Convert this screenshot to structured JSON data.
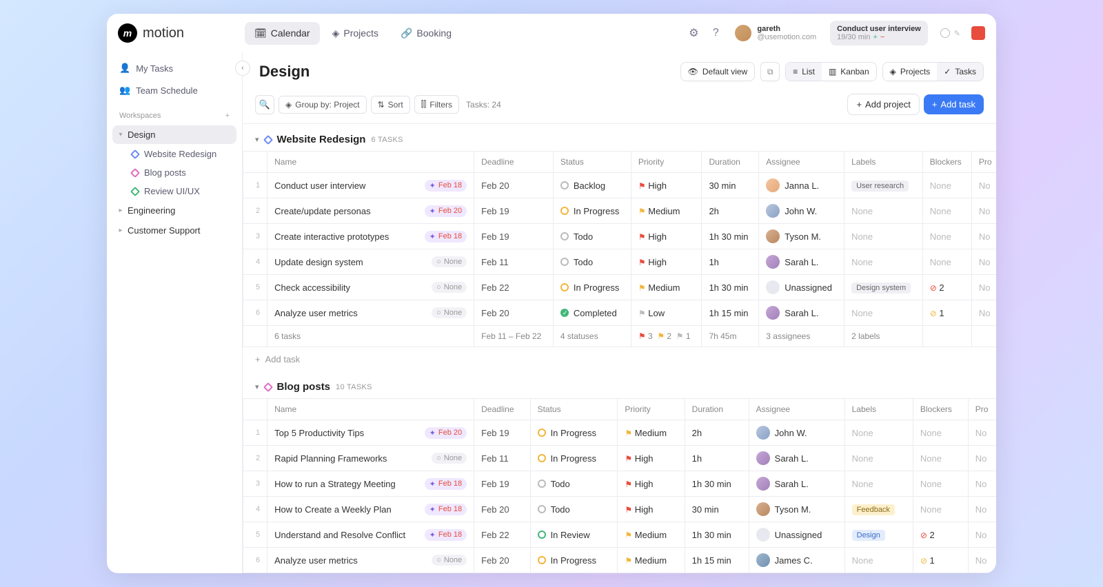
{
  "brand": "motion",
  "topnav": {
    "calendar": "Calendar",
    "projects": "Projects",
    "booking": "Booking"
  },
  "user": {
    "name": "gareth",
    "email": "@usemotion.com"
  },
  "timer": {
    "title": "Conduct user interview",
    "sub": "19/30 min"
  },
  "sidebar": {
    "mytasks": "My Tasks",
    "team": "Team Schedule",
    "wslabel": "Workspaces",
    "design": "Design",
    "wr": "Website Redesign",
    "bp": "Blog posts",
    "ru": "Review UI/UX",
    "eng": "Engineering",
    "cs": "Customer Support"
  },
  "page": {
    "title": "Design",
    "default_view": "Default view",
    "list": "List",
    "kanban": "Kanban",
    "projects_tab": "Projects",
    "tasks_tab": "Tasks"
  },
  "toolbar": {
    "group": "Group by: Project",
    "sort": "Sort",
    "filters": "Filters",
    "count": "Tasks: 24",
    "add_project": "Add project",
    "add_task": "Add task"
  },
  "headers": {
    "name": "Name",
    "deadline": "Deadline",
    "status": "Status",
    "priority": "Priority",
    "duration": "Duration",
    "assignee": "Assignee",
    "labels": "Labels",
    "blockers": "Blockers",
    "project": "Pro"
  },
  "projA": {
    "title": "Website Redesign",
    "count": "6 TASKS",
    "rows": [
      {
        "i": "1",
        "name": "Conduct user interview",
        "auto": "Feb 18",
        "autotype": "sched",
        "dl": "Feb 20",
        "st": "Backlog",
        "stc": "backlog",
        "pr": "High",
        "prc": "high",
        "dur": "30 min",
        "as": "Janna L.",
        "av": "av1",
        "lbl": "User research",
        "lblc": "tag-gray",
        "blk": "None",
        "prj": "No"
      },
      {
        "i": "2",
        "name": "Create/update personas",
        "auto": "Feb 20",
        "autotype": "sched",
        "dl": "Feb 19",
        "st": "In Progress",
        "stc": "prog",
        "pr": "Medium",
        "prc": "med",
        "dur": "2h",
        "as": "John W.",
        "av": "av2",
        "lbl": "None",
        "lblc": "",
        "blk": "None",
        "prj": "No"
      },
      {
        "i": "3",
        "name": "Create interactive prototypes",
        "auto": "Feb 18",
        "autotype": "sched",
        "dl": "Feb 19",
        "st": "Todo",
        "stc": "todo",
        "pr": "High",
        "prc": "high",
        "dur": "1h 30 min",
        "as": "Tyson M.",
        "av": "av3",
        "lbl": "None",
        "lblc": "",
        "blk": "None",
        "prj": "No"
      },
      {
        "i": "4",
        "name": "Update design system",
        "auto": "None",
        "autotype": "none",
        "dl": "Feb 11",
        "st": "Todo",
        "stc": "todo",
        "pr": "High",
        "prc": "high",
        "dur": "1h",
        "as": "Sarah L.",
        "av": "av4",
        "lbl": "None",
        "lblc": "",
        "blk": "None",
        "prj": "No"
      },
      {
        "i": "5",
        "name": "Check accessibility",
        "auto": "None",
        "autotype": "none",
        "dl": "Feb 22",
        "st": "In Progress",
        "stc": "prog",
        "pr": "Medium",
        "prc": "med",
        "dur": "1h 30 min",
        "as": "Unassigned",
        "av": "av-un",
        "lbl": "Design system",
        "lblc": "tag-gray",
        "blk": "2",
        "blkico": "r",
        "prj": "No"
      },
      {
        "i": "6",
        "name": "Analyze user metrics",
        "auto": "None",
        "autotype": "none",
        "dl": "Feb 20",
        "st": "Completed",
        "stc": "done",
        "pr": "Low",
        "prc": "low",
        "dur": "1h 15 min",
        "as": "Sarah L.",
        "av": "av4",
        "lbl": "None",
        "lblc": "",
        "blk": "1",
        "blkico": "y",
        "prj": "No"
      }
    ],
    "summary": {
      "tasks": "6 tasks",
      "dl": "Feb 11 – Feb 22",
      "st": "4 statuses",
      "pr1": "3",
      "pr2": "2",
      "pr3": "1",
      "dur": "7h 45m",
      "as": "3 assignees",
      "lbl": "2 labels"
    }
  },
  "projB": {
    "title": "Blog posts",
    "count": "10 TASKS",
    "rows": [
      {
        "i": "1",
        "name": "Top 5 Productivity Tips",
        "auto": "Feb 20",
        "autotype": "sched",
        "dl": "Feb 19",
        "st": "In Progress",
        "stc": "prog",
        "pr": "Medium",
        "prc": "med",
        "dur": "2h",
        "as": "John W.",
        "av": "av2",
        "lbl": "None",
        "lblc": "",
        "blk": "None",
        "prj": "No"
      },
      {
        "i": "2",
        "name": "Rapid Planning Frameworks",
        "auto": "None",
        "autotype": "none",
        "dl": "Feb 11",
        "st": "In Progress",
        "stc": "prog",
        "pr": "High",
        "prc": "high",
        "dur": "1h",
        "as": "Sarah L.",
        "av": "av4",
        "lbl": "None",
        "lblc": "",
        "blk": "None",
        "prj": "No"
      },
      {
        "i": "3",
        "name": "How to run a Strategy Meeting",
        "auto": "Feb 18",
        "autotype": "sched",
        "dl": "Feb 19",
        "st": "Todo",
        "stc": "todo",
        "pr": "High",
        "prc": "high",
        "dur": "1h 30 min",
        "as": "Sarah L.",
        "av": "av4",
        "lbl": "None",
        "lblc": "",
        "blk": "None",
        "prj": "No"
      },
      {
        "i": "4",
        "name": "How to Create a Weekly Plan",
        "auto": "Feb 18",
        "autotype": "sched",
        "dl": "Feb 20",
        "st": "Todo",
        "stc": "todo",
        "pr": "High",
        "prc": "high",
        "dur": "30 min",
        "as": "Tyson M.",
        "av": "av3",
        "lbl": "Feedback",
        "lblc": "tag-yell",
        "blk": "None",
        "prj": "No"
      },
      {
        "i": "5",
        "name": "Understand and Resolve Conflict",
        "auto": "Feb 18",
        "autotype": "sched",
        "dl": "Feb 22",
        "st": "In Review",
        "stc": "review",
        "pr": "Medium",
        "prc": "med",
        "dur": "1h 30 min",
        "as": "Unassigned",
        "av": "av-un",
        "lbl": "Design",
        "lblc": "tag-blue",
        "blk": "2",
        "blkico": "r",
        "prj": "No"
      },
      {
        "i": "6",
        "name": "Analyze user metrics",
        "auto": "None",
        "autotype": "none",
        "dl": "Feb 20",
        "st": "In Progress",
        "stc": "prog",
        "pr": "Medium",
        "prc": "med",
        "dur": "1h 15 min",
        "as": "James C.",
        "av": "av5",
        "lbl": "None",
        "lblc": "",
        "blk": "1",
        "blkico": "y",
        "prj": "No"
      }
    ]
  },
  "add_task_inline": "Add task"
}
